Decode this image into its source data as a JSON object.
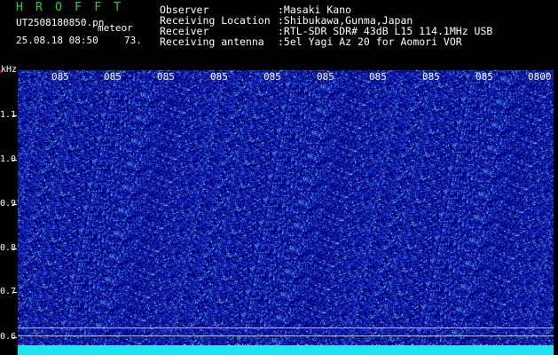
{
  "header": {
    "app_title": "H R O F F T",
    "file_name": "UT2508180850.pn",
    "mode": "meteor",
    "datetime": "25.08.18 08:50",
    "count": "73.",
    "info": [
      {
        "key": "Observer",
        "value": ":Masaki Kano"
      },
      {
        "key": "Receiving Location",
        "value": ":Shibukawa,Gunma,Japan"
      },
      {
        "key": "Receiver",
        "value": ":RTL-SDR SDR# 43dB L15 114.1MHz USB"
      },
      {
        "key": "Receiving antenna",
        "value": ":5el Yagi Az 20 for Aomori VOR"
      }
    ]
  },
  "spectrogram": {
    "y_unit": "kHz",
    "y_labels": [
      "1.1",
      "1.0",
      "0.9",
      "0.8",
      "0.7",
      "0.6"
    ],
    "x_labels": [
      "085",
      "085",
      "085",
      "085",
      "085",
      "085",
      "085",
      "085",
      "085",
      "0800"
    ],
    "colors": {
      "background": "#00007a",
      "baseline": "#19e6f0",
      "text": "#ffffff",
      "title": "#2bd12b"
    }
  }
}
